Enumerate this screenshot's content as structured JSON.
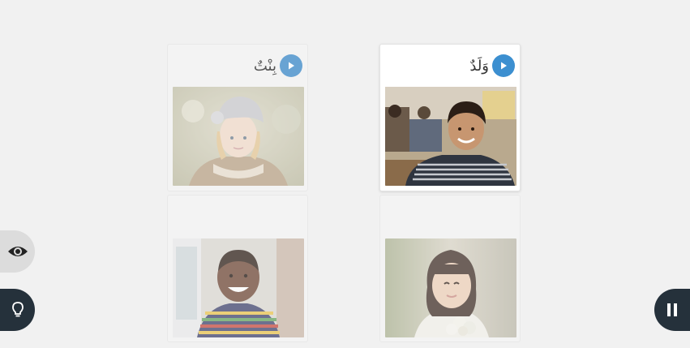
{
  "cards": [
    {
      "word": "بِنْتٌ",
      "photo": "girl-in-knit-hat",
      "state": "dimmed"
    },
    {
      "word": "وَلَدٌ",
      "photo": "boy-in-classroom",
      "state": "selected"
    },
    {
      "word": "",
      "photo": "smiling-boy-striped-shirt",
      "state": "dimmed"
    },
    {
      "word": "",
      "photo": "girl-with-flowers",
      "state": "dimmed"
    }
  ],
  "controls": {
    "reveal": "eye-icon",
    "hint": "lightbulb-icon",
    "pause": "pause-icon"
  },
  "colors": {
    "background": "#f1f1f1",
    "play_button": "#3c8fd0",
    "dark_button": "#25313b"
  }
}
